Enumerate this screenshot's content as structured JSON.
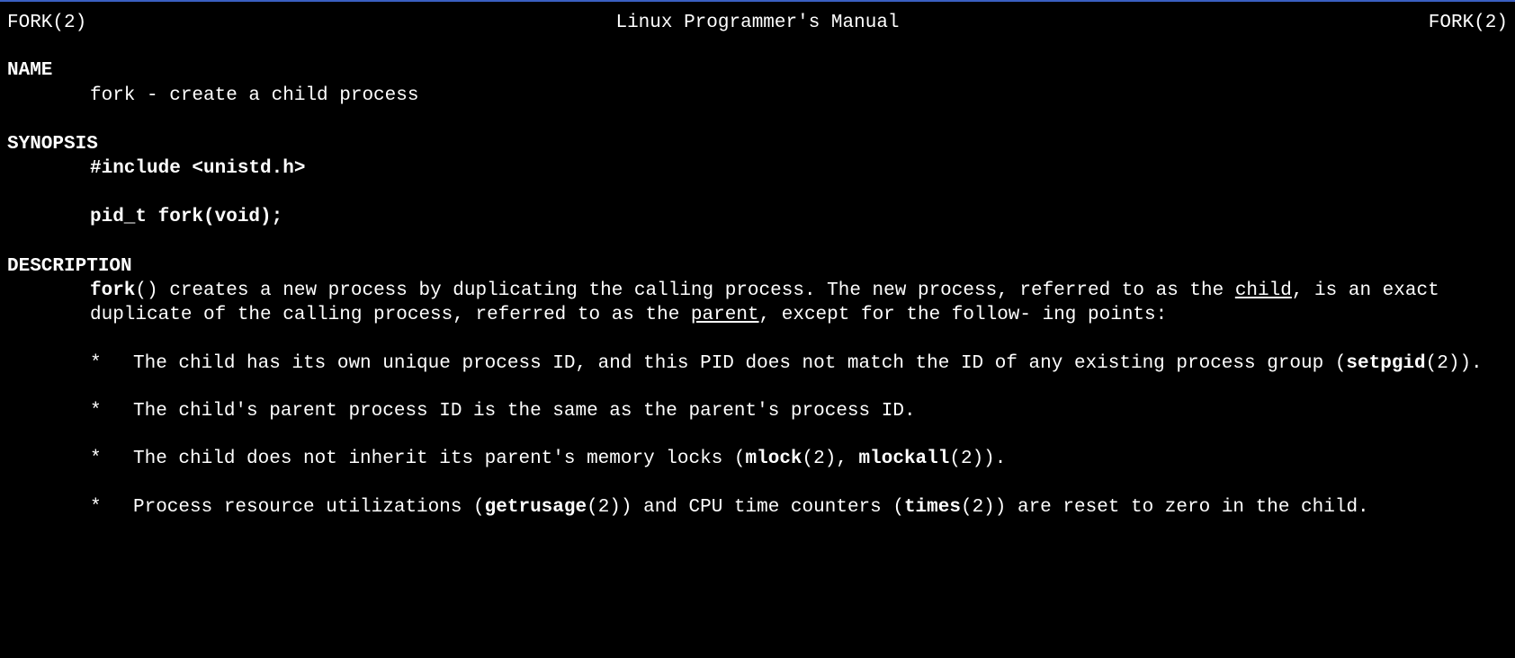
{
  "header": {
    "left": "FORK(2)",
    "center": "Linux Programmer's Manual",
    "right": "FORK(2)"
  },
  "sections": {
    "name": {
      "heading": "NAME",
      "text": "fork - create a child process"
    },
    "synopsis": {
      "heading": "SYNOPSIS",
      "include": "#include <unistd.h>",
      "decl": "pid_t fork(void);"
    },
    "description": {
      "heading": "DESCRIPTION",
      "intro": {
        "fork": "fork",
        "p1a": "()  creates a new process by duplicating the calling process.  The new process, referred to as the ",
        "child": "child",
        "p1b": ", is an exact duplicate of the calling process, referred to as the ",
        "parent": "parent",
        "p1c": ", except for the follow‐ ing points:"
      },
      "bullets": [
        {
          "marker": "*",
          "pre": "The child has its own unique process ID, and this PID does not match the ID of any existing process group (",
          "bold1": "setpgid",
          "post": "(2))."
        },
        {
          "marker": "*",
          "pre": "The child's parent process ID is the same as the parent's process ID.",
          "bold1": "",
          "post": ""
        },
        {
          "marker": "*",
          "pre": "The child does not inherit its parent's memory locks (",
          "bold1": "mlock",
          "mid1": "(2), ",
          "bold2": "mlockall",
          "post": "(2))."
        },
        {
          "marker": "*",
          "pre": "Process resource utilizations (",
          "bold1": "getrusage",
          "mid1": "(2)) and CPU time counters (",
          "bold2": "times",
          "post": "(2)) are reset to zero  in the child."
        }
      ]
    }
  }
}
